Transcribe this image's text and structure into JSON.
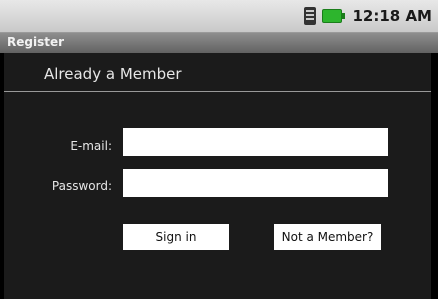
{
  "status_bar": {
    "time": "12:18 AM",
    "icons": [
      "sim-icon",
      "battery-icon"
    ],
    "battery_color": "#2db52d"
  },
  "title_bar": {
    "title": "Register"
  },
  "section": {
    "title": "Already a Member"
  },
  "form": {
    "email_label": "E-mail:",
    "email_value": "",
    "password_label": "Password:",
    "password_value": ""
  },
  "buttons": {
    "sign_in": "Sign in",
    "not_member": "Not a Member?"
  }
}
